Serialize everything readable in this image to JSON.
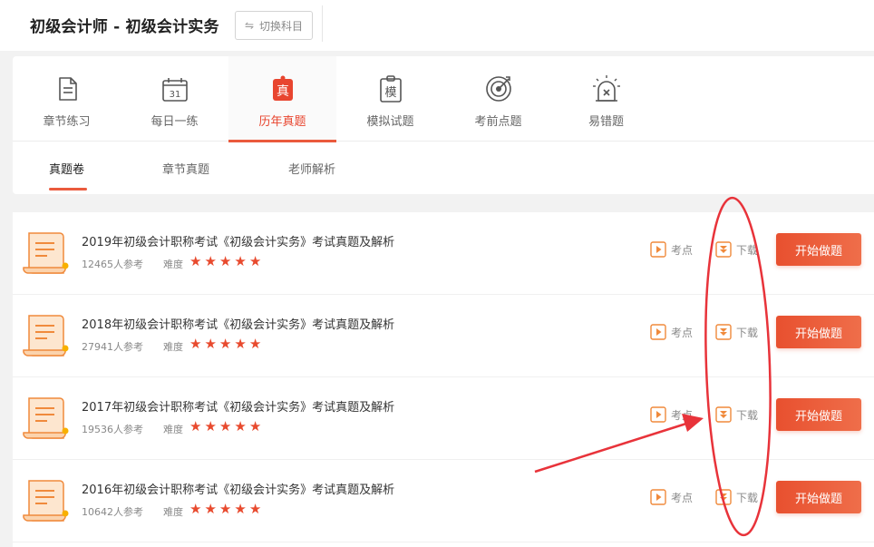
{
  "header": {
    "title": "初级会计师 - 初级会计实务",
    "switch_label": "切换科目",
    "switch_icon": "swap-icon"
  },
  "tabs": [
    {
      "label": "章节练习",
      "icon": "document-icon",
      "active": false
    },
    {
      "label": "每日一练",
      "icon": "calendar-icon",
      "icon_text": "31",
      "active": false
    },
    {
      "label": "历年真题",
      "icon": "exam-real-icon",
      "icon_text": "真",
      "active": true
    },
    {
      "label": "模拟试题",
      "icon": "mock-test-icon",
      "icon_text": "模",
      "active": false
    },
    {
      "label": "考前点题",
      "icon": "target-icon",
      "active": false
    },
    {
      "label": "易错题",
      "icon": "alarm-icon",
      "active": false
    }
  ],
  "subtabs": [
    {
      "label": "真题卷",
      "active": true
    },
    {
      "label": "章节真题",
      "active": false
    },
    {
      "label": "老师解析",
      "active": false
    }
  ],
  "papers": [
    {
      "title": "2019年初级会计职称考试《初级会计实务》考试真题及解析",
      "participants": "12465人参考",
      "difficulty_label": "难度",
      "stars": 5,
      "points_label": "考点",
      "download_label": "下载",
      "start_label": "开始做题"
    },
    {
      "title": "2018年初级会计职称考试《初级会计实务》考试真题及解析",
      "participants": "27941人参考",
      "difficulty_label": "难度",
      "stars": 5,
      "points_label": "考点",
      "download_label": "下载",
      "start_label": "开始做题"
    },
    {
      "title": "2017年初级会计职称考试《初级会计实务》考试真题及解析",
      "participants": "19536人参考",
      "difficulty_label": "难度",
      "stars": 5,
      "points_label": "考点",
      "download_label": "下载",
      "start_label": "开始做题"
    },
    {
      "title": "2016年初级会计职称考试《初级会计实务》考试真题及解析",
      "participants": "10642人参考",
      "difficulty_label": "难度",
      "stars": 5,
      "points_label": "考点",
      "download_label": "下载",
      "start_label": "开始做题"
    }
  ],
  "colors": {
    "accent": "#ea5a3d",
    "star": "#e84a2e",
    "icon_orange": "#f08a3c",
    "annotation_red": "#e8333a"
  }
}
